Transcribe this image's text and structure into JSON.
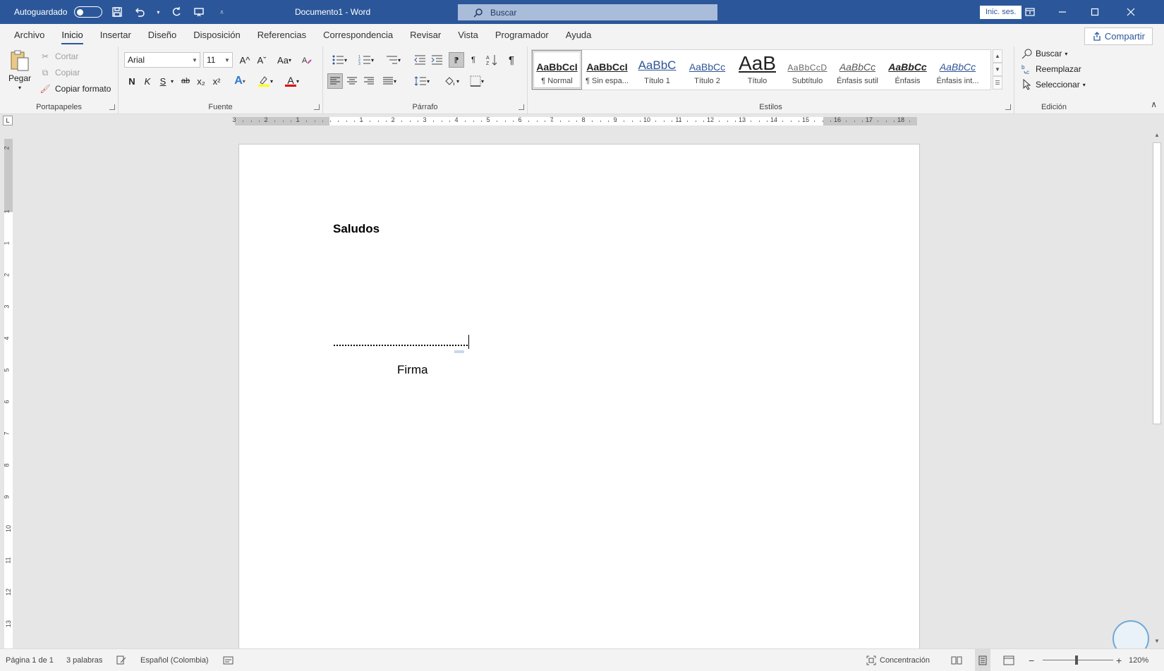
{
  "titlebar": {
    "autosave_label": "Autoguardado",
    "doc_title": "Documento1  -  Word",
    "search_placeholder": "Buscar",
    "signin_label": "Inic. ses."
  },
  "tabs": [
    "Archivo",
    "Inicio",
    "Insertar",
    "Diseño",
    "Disposición",
    "Referencias",
    "Correspondencia",
    "Revisar",
    "Vista",
    "Programador",
    "Ayuda"
  ],
  "active_tab": "Inicio",
  "share_label": "Compartir",
  "clipboard": {
    "paste_label": "Pegar",
    "cut_label": "Cortar",
    "copy_label": "Copiar",
    "format_painter_label": "Copiar formato",
    "group_label": "Portapapeles"
  },
  "font": {
    "font_name": "Arial",
    "font_size": "11",
    "grow_label": "A^",
    "shrink_label": "Aˇ",
    "case_label": "Aa",
    "bold_label": "N",
    "italic_label": "K",
    "underline_label": "S",
    "strike_label": "ab",
    "subscript_label": "x₂",
    "superscript_label": "x²",
    "text_effects_label": "A",
    "font_color_label": "A",
    "group_label": "Fuente"
  },
  "paragraph": {
    "group_label": "Párrafo",
    "pilcrow": "¶"
  },
  "styles": {
    "group_label": "Estilos",
    "items": [
      {
        "preview": "AaBbCcI",
        "name": "¶ Normal"
      },
      {
        "preview": "AaBbCcI",
        "name": "¶ Sin espa..."
      },
      {
        "preview": "AaBbC",
        "name": "Título 1"
      },
      {
        "preview": "AaBbCc",
        "name": "Título 2"
      },
      {
        "preview": "AaB",
        "name": "Título"
      },
      {
        "preview": "AaBbCcD",
        "name": "Subtítulo"
      },
      {
        "preview": "AaBbCc",
        "name": "Énfasis sutil"
      },
      {
        "preview": "AaBbCc",
        "name": "Énfasis"
      },
      {
        "preview": "AaBbCc",
        "name": "Énfasis int..."
      }
    ]
  },
  "editing": {
    "group_label": "Edición",
    "find_label": "Buscar",
    "replace_label": "Reemplazar",
    "select_label": "Seleccionar"
  },
  "ruler": {
    "h_numbers": [
      "3",
      "2",
      "1",
      "1",
      "2",
      "3",
      "4",
      "5",
      "6",
      "7",
      "8",
      "9",
      "10",
      "11",
      "12",
      "13",
      "14",
      "15",
      "16",
      "17",
      "18"
    ],
    "v_numbers": [
      "2",
      "1",
      "1",
      "2",
      "3",
      "4",
      "5",
      "6",
      "7",
      "8",
      "9",
      "10",
      "11",
      "12",
      "13"
    ]
  },
  "document": {
    "heading": "Saludos",
    "signature_label": "Firma"
  },
  "status": {
    "page": "Página 1 de 1",
    "words": "3 palabras",
    "language": "Español (Colombia)",
    "focus": "Concentración",
    "zoom": "120%"
  },
  "colors": {
    "brand": "#2b579a",
    "highlight": "#ffff00",
    "font_color": "#e00000"
  }
}
